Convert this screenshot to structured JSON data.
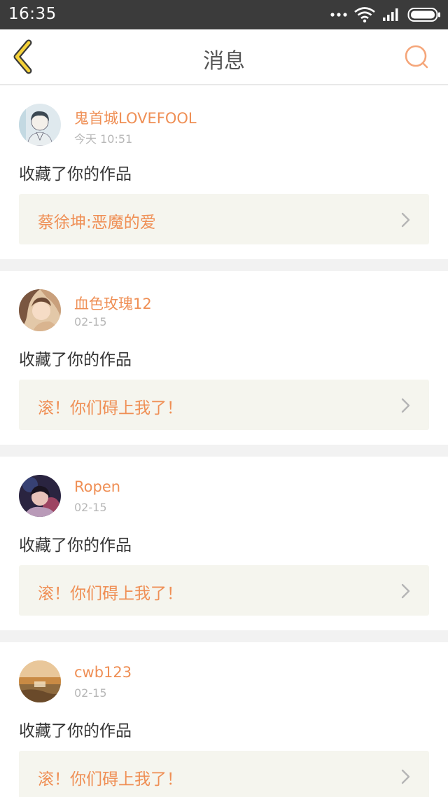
{
  "status_bar": {
    "time": "16:35",
    "icons": [
      "more-dots-icon",
      "wifi-icon",
      "signal-icon",
      "battery-icon"
    ]
  },
  "header": {
    "title": "消息",
    "back_icon": "chevron-left-icon",
    "search_icon": "search-icon",
    "accent_color": "#f5a623"
  },
  "messages": [
    {
      "username": "鬼首城LOVEFOOL",
      "time": "今天 10:51",
      "action": "收藏了你的作品",
      "work_title": "蔡徐坤:恶魔的爱"
    },
    {
      "username": "血色玫瑰12",
      "time": "02-15",
      "action": "收藏了你的作品",
      "work_title": "滚！你们碍上我了！"
    },
    {
      "username": "Ropen",
      "time": "02-15",
      "action": "收藏了你的作品",
      "work_title": "滚！你们碍上我了！"
    },
    {
      "username": "cwb123",
      "time": "02-15",
      "action": "收藏了你的作品",
      "work_title": "滚！你们碍上我了！"
    }
  ],
  "colors": {
    "username": "#ef8f55",
    "work_title": "#ef8f55",
    "link_bg": "#f5f5ee",
    "status_bar": "#3b3b3b"
  }
}
